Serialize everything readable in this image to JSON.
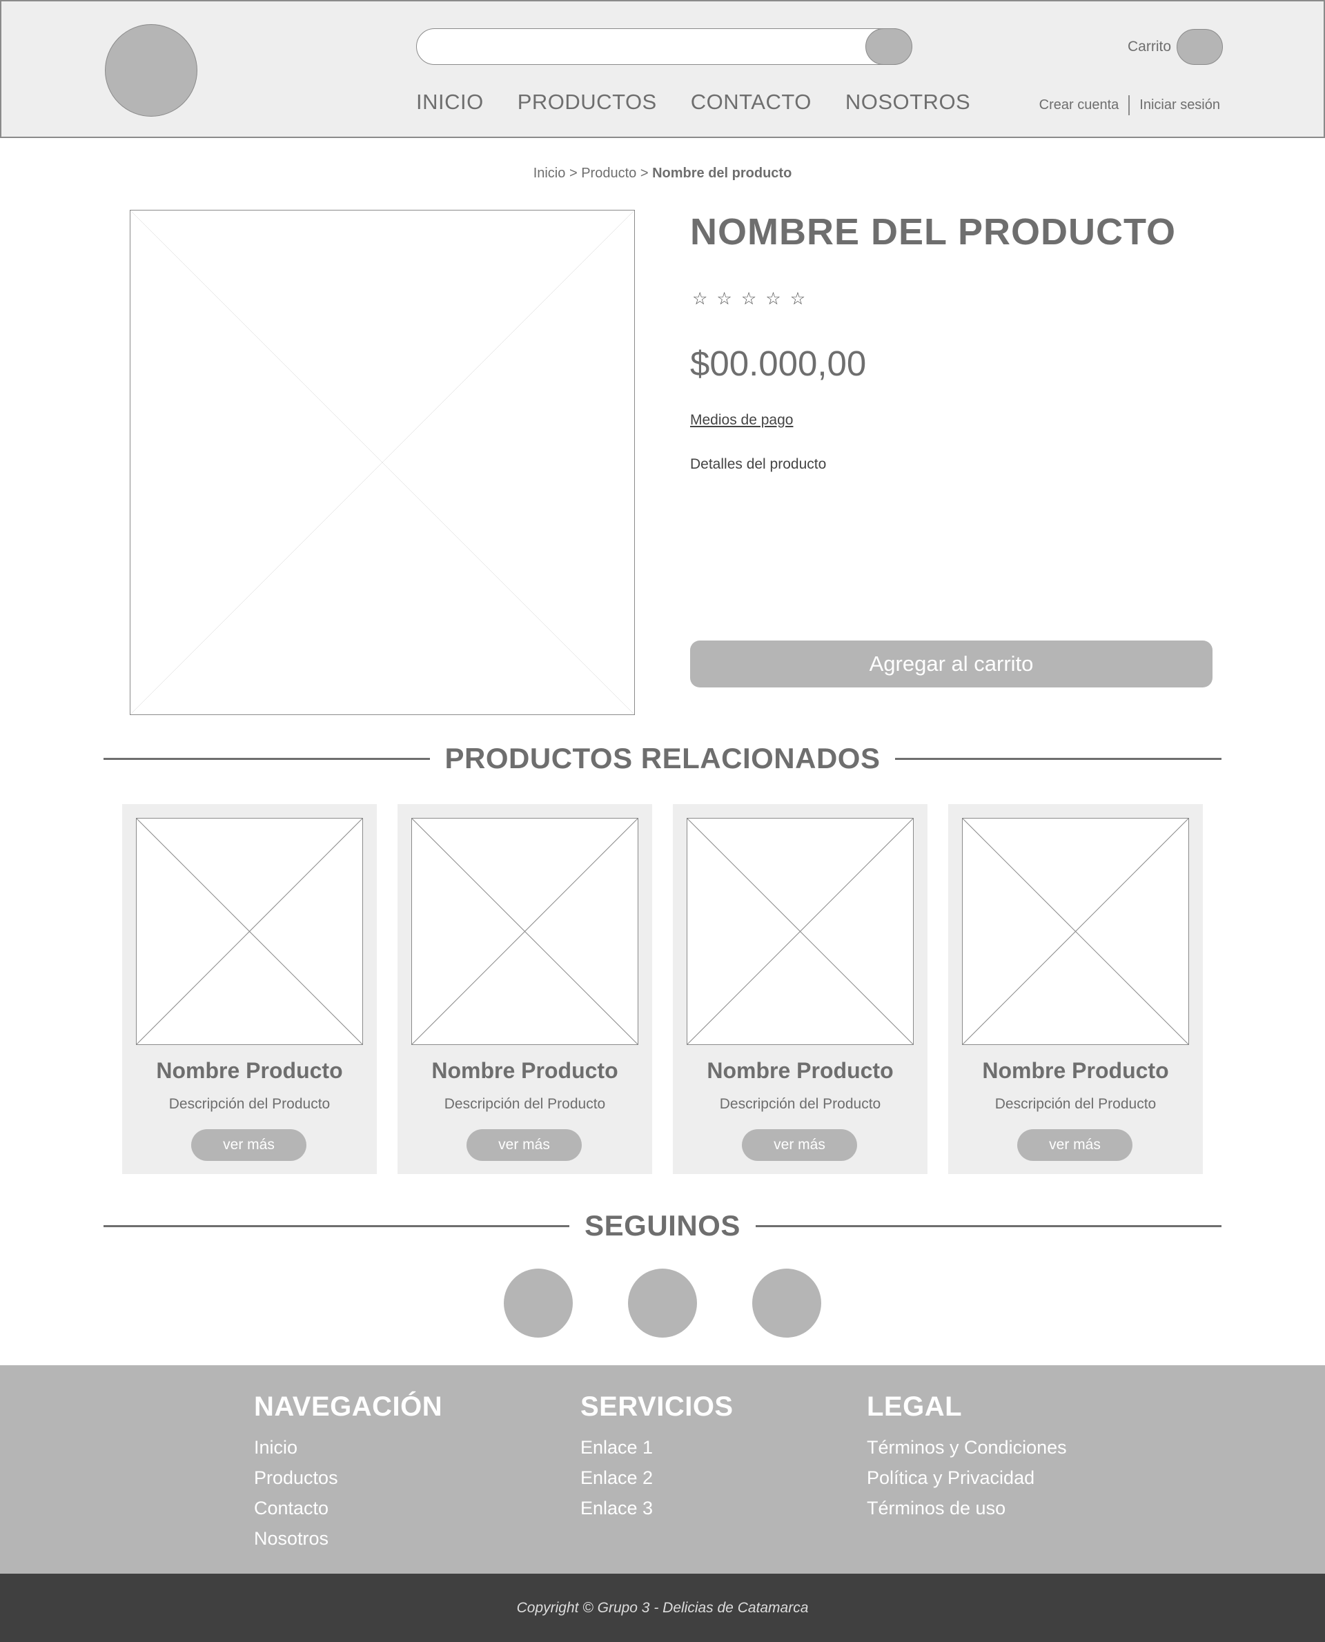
{
  "header": {
    "cart_label": "Carrito",
    "nav": [
      "INICIO",
      "PRODUCTOS",
      "CONTACTO",
      "NOSOTROS"
    ],
    "create_account": "Crear cuenta",
    "login": "Iniciar sesión"
  },
  "breadcrumb": {
    "home": "Inicio",
    "separator": ">",
    "section": "Producto",
    "current": "Nombre del producto"
  },
  "product": {
    "title": "NOMBRE DEL PRODUCTO",
    "rating": 0,
    "rating_max": 5,
    "price": "$00.000,00",
    "payment_link": "Medios de pago",
    "details": "Detalles del producto",
    "add_to_cart": "Agregar al carrito"
  },
  "related": {
    "title": "PRODUCTOS RELACIONADOS",
    "cards": [
      {
        "name": "Nombre Producto",
        "description": "Descripción del Producto",
        "button": "ver más"
      },
      {
        "name": "Nombre Producto",
        "description": "Descripción del Producto",
        "button": "ver más"
      },
      {
        "name": "Nombre Producto",
        "description": "Descripción del Producto",
        "button": "ver más"
      },
      {
        "name": "Nombre Producto",
        "description": "Descripción del Producto",
        "button": "ver más"
      }
    ]
  },
  "follow": {
    "title": "SEGUINOS"
  },
  "footer": {
    "columns": [
      {
        "title": "NAVEGACIÓN",
        "links": [
          "Inicio",
          "Productos",
          "Contacto",
          "Nosotros"
        ]
      },
      {
        "title": "SERVICIOS",
        "links": [
          "Enlace 1",
          "Enlace 2",
          "Enlace 3"
        ]
      },
      {
        "title": "LEGAL",
        "links": [
          "Términos y Condiciones",
          "Política y Privacidad",
          "Términos de uso"
        ]
      }
    ],
    "copyright": "Copyright © Grupo 3 - Delicias de Catamarca"
  },
  "colors": {
    "header_bg": "#eeeeee",
    "placeholder_gray": "#b5b5b5",
    "footer_bg": "#b5b5b5",
    "copyright_bg": "#404040",
    "text_gray": "#6e6e6e"
  }
}
